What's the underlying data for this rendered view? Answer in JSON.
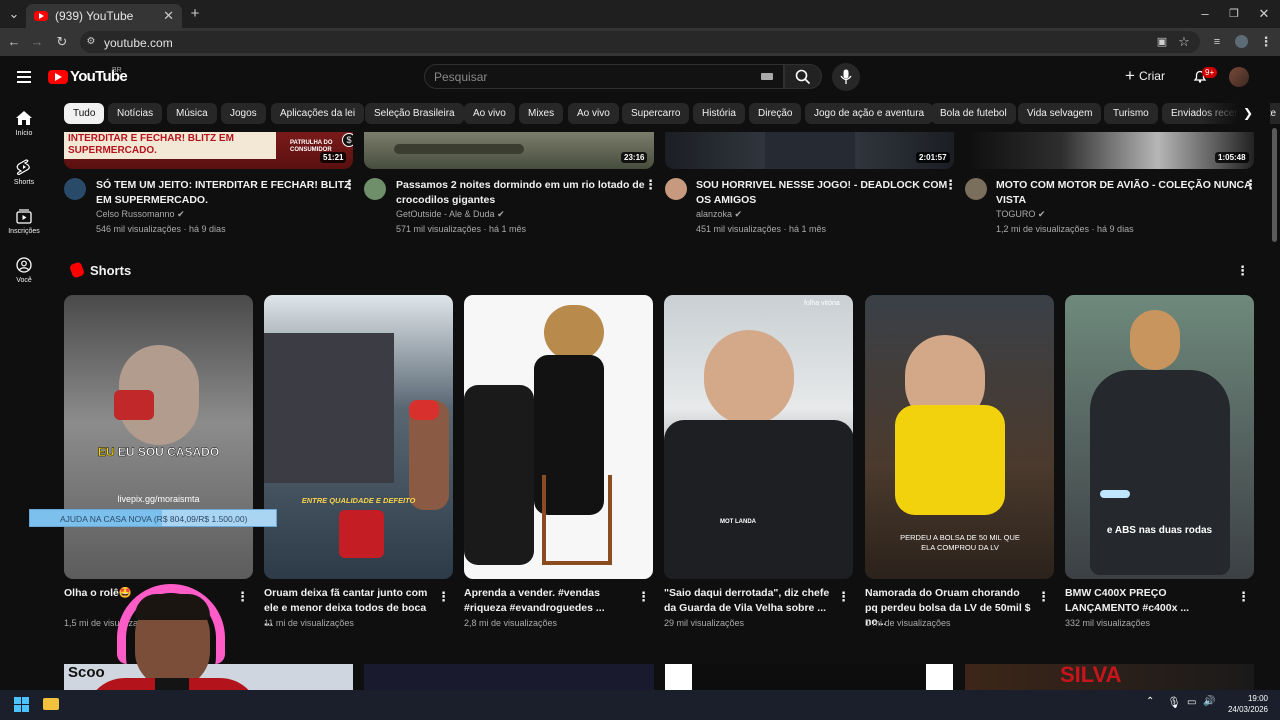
{
  "browser": {
    "tab_title": "(939) YouTube",
    "url": "youtube.com",
    "new_tab_label": "+"
  },
  "header": {
    "logo_text": "YouTube",
    "region": "BR",
    "search_placeholder": "Pesquisar",
    "create_label": "Criar",
    "notifications_badge": "9+"
  },
  "chips": [
    "Tudo",
    "Notícias",
    "Música",
    "Jogos",
    "Aplicações da lei",
    "Seleção Brasileira",
    "Ao vivo",
    "Mixes",
    "Ao vivo",
    "Supercarro",
    "História",
    "Direção",
    "Jogo de ação e aventura",
    "Bola de futebol",
    "Vida selvagem",
    "Turismo",
    "Enviados recentemente"
  ],
  "sidebar": [
    {
      "label": "Início",
      "icon": "home-icon"
    },
    {
      "label": "Shorts",
      "icon": "shorts-icon"
    },
    {
      "label": "Inscrições",
      "icon": "subscriptions-icon"
    },
    {
      "label": "Você",
      "icon": "you-icon"
    }
  ],
  "videos": [
    {
      "title": "SÓ TEM UM JEITO: INTERDITAR E FECHAR! BLITZ EM SUPERMERCADO.",
      "channel": "Celso Russomanno",
      "meta": "546 mil visualizações · há 9 dias",
      "duration": "51:21",
      "thumb_text": "INTERDITAR E FECHAR! BLITZ EM SUPERMERCADO.",
      "thumb_badge": "PATRULHA DO CONSUMIDOR"
    },
    {
      "title": "Passamos 2 noites dormindo em um rio lotado de crocodilos gigantes",
      "channel": "GetOutside - Ale & Duda",
      "meta": "571 mil visualizações · há 1 mês",
      "duration": "23:16"
    },
    {
      "title": "SOU HORRIVEL NESSE JOGO! - DEADLOCK COM OS AMIGOS",
      "channel": "alanzoka",
      "meta": "451 mil visualizações · há 1 mês",
      "duration": "2:01:57"
    },
    {
      "title": "MOTO COM MOTOR DE AVIÃO - COLEÇÃO NUNCA VISTA",
      "channel": "TOGURO",
      "meta": "1,2 mi de visualizações · há 9 dias",
      "duration": "1:05:48"
    }
  ],
  "shorts_section": {
    "title": "Shorts",
    "items": [
      {
        "title": "Olha o rolê🤩",
        "views": "1,5 mi de visualizações",
        "caption": "EU SOU CASADO",
        "caption2": "livepix.gg/moraismta"
      },
      {
        "title": "Oruam deixa fã cantar junto com ele e menor deixa todos de boca ...",
        "views": "11 mi de visualizações",
        "caption": "ENTRE QUALIDADE E DEFEITO"
      },
      {
        "title": "Aprenda a vender. #vendas #riqueza #evandroguedes ...",
        "views": "2,8 mi de visualizações"
      },
      {
        "title": "\"Saio daqui derrotada\", diz chefe da Guarda de Vila Velha sobre ...",
        "views": "29 mil visualizações",
        "caption": "folha vitória",
        "caption2": "MOT LANDA"
      },
      {
        "title": "Namorada do Oruam chorando pq perdeu bolsa da LV de 50mil $ no...",
        "views": "1 mi de visualizações",
        "caption": "PERDEU A BOLSA DE 50 MIL QUE ELA COMPROU DA LV"
      },
      {
        "title": "BMW C400X PREÇO LANÇAMENTO #c400x ...",
        "views": "332 mil visualizações",
        "caption": "e ABS nas duas rodas"
      }
    ]
  },
  "overlay": {
    "donation_text": "AJUDA NA CASA NOVA (R$ 804,09/R$ 1.500,00)",
    "donation_progress": 0.536
  },
  "bottom_row": {
    "thumb_text_1": "Scoo",
    "thumb_text_2": "SILVA"
  },
  "taskbar": {
    "time": "19:00",
    "date": "24/03/2026"
  }
}
